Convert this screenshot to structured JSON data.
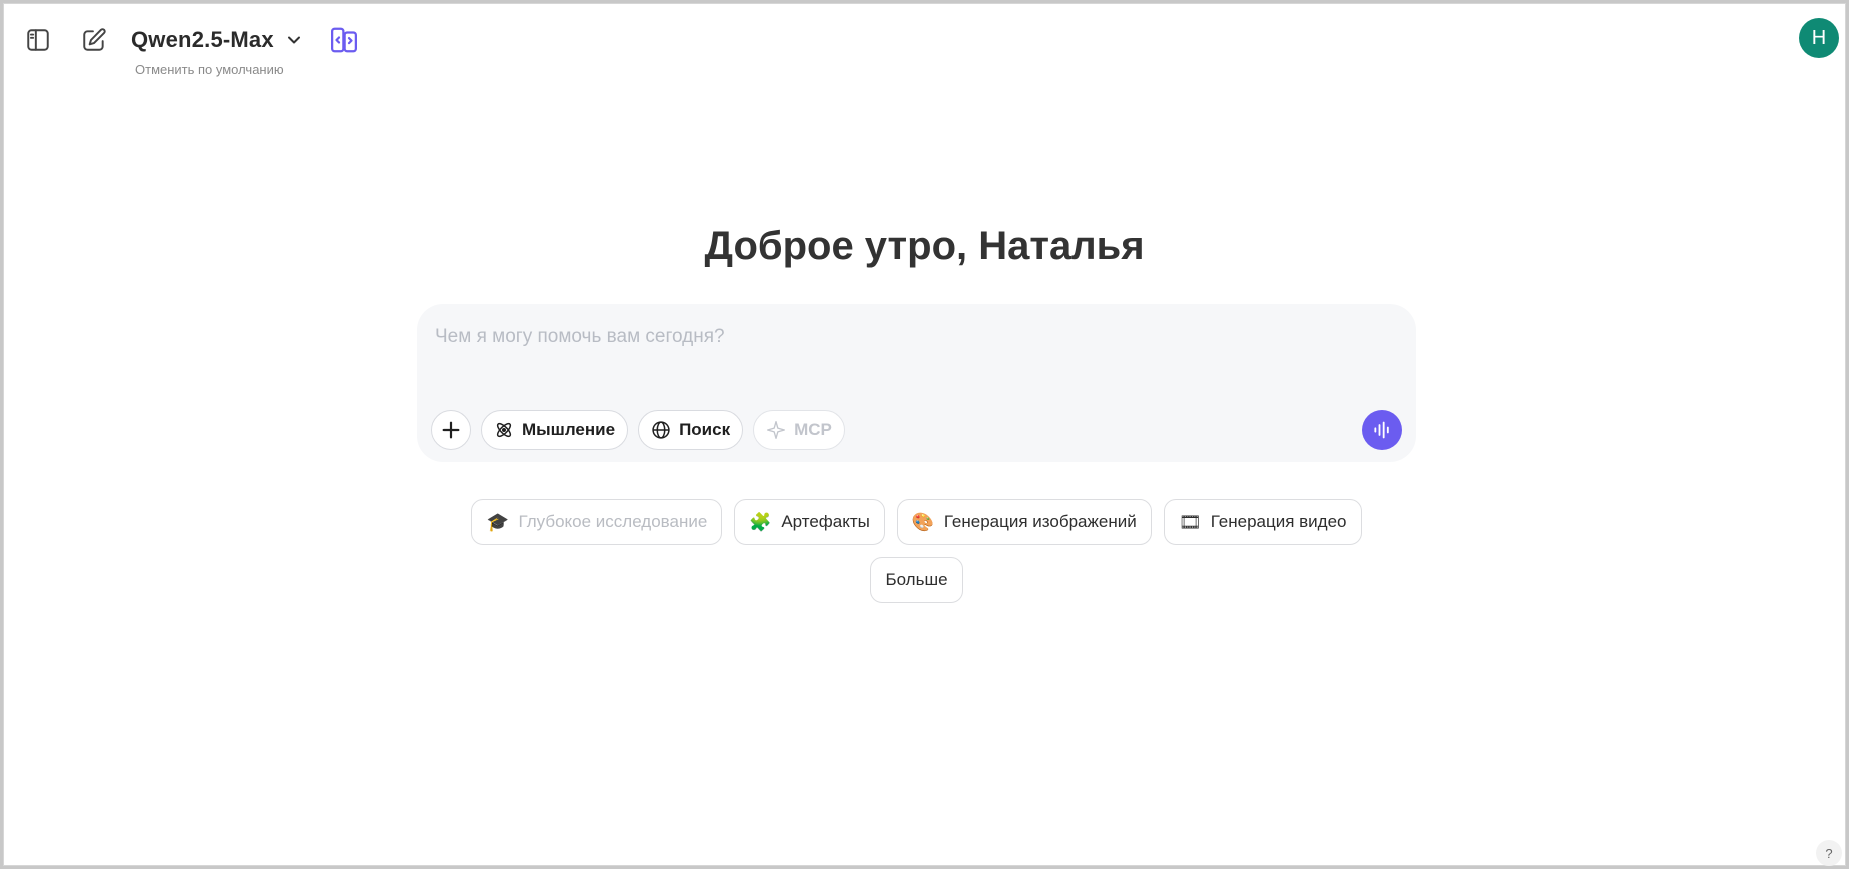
{
  "header": {
    "model_name": "Qwen2.5-Max",
    "model_subtitle": "Отменить по умолчанию",
    "avatar_initial": "H",
    "icons": [
      "sidebar-toggle-icon",
      "new-chat-icon",
      "chevron-down-icon",
      "compare-models-icon"
    ]
  },
  "greeting": "Доброе утро, Наталья",
  "composer": {
    "value": "",
    "placeholder": "Чем я могу помочь вам сегодня?",
    "tools": {
      "thinking_label": "Мышление",
      "search_label": "Поиск",
      "mcp_label": "MCP"
    }
  },
  "suggestions": {
    "deep_research": "Глубокое исследование",
    "artifacts": "Артефакты",
    "image_generation": "Генерация изображений",
    "video_generation": "Генерация видео",
    "more": "Больше"
  },
  "help_label": "?",
  "colors": {
    "accent": "#6b5cf0",
    "avatar_bg": "#0f8a74",
    "compare_icon": "#6b5cf0"
  }
}
